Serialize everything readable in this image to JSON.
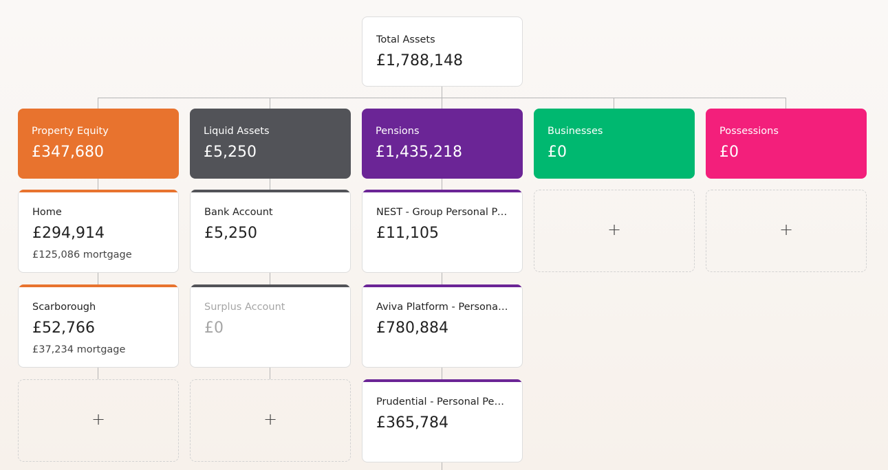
{
  "colors": {
    "property": "#e8732e",
    "liquid": "#525358",
    "pensions": "#6b2596",
    "businesses": "#00b870",
    "possessions": "#f31f7b",
    "connector": "#b5b5b5"
  },
  "total": {
    "label": "Total Assets",
    "value": "£1,788,148"
  },
  "categories": [
    {
      "label": "Property Equity",
      "value": "£347,680",
      "items": [
        {
          "label": "Home",
          "value": "£294,914",
          "sub": "£125,086 mortgage"
        },
        {
          "label": "Scarborough",
          "value": "£52,766",
          "sub": "£37,234 mortgage"
        }
      ],
      "add_label": "+"
    },
    {
      "label": "Liquid Assets",
      "value": "£5,250",
      "items": [
        {
          "label": "Bank Account",
          "value": "£5,250"
        },
        {
          "label": "Surplus Account",
          "value": "£0"
        }
      ],
      "add_label": "+"
    },
    {
      "label": "Pensions",
      "value": "£1,435,218",
      "items": [
        {
          "label": "NEST - Group Personal Pension",
          "value": "£11,105"
        },
        {
          "label": "Aviva Platform - Personal Pension",
          "value": "£780,884"
        },
        {
          "label": "Prudential - Personal Pension",
          "value": "£365,784"
        }
      ]
    },
    {
      "label": "Businesses",
      "value": "£0",
      "add_label": "+"
    },
    {
      "label": "Possessions",
      "value": "£0",
      "add_label": "+"
    }
  ]
}
